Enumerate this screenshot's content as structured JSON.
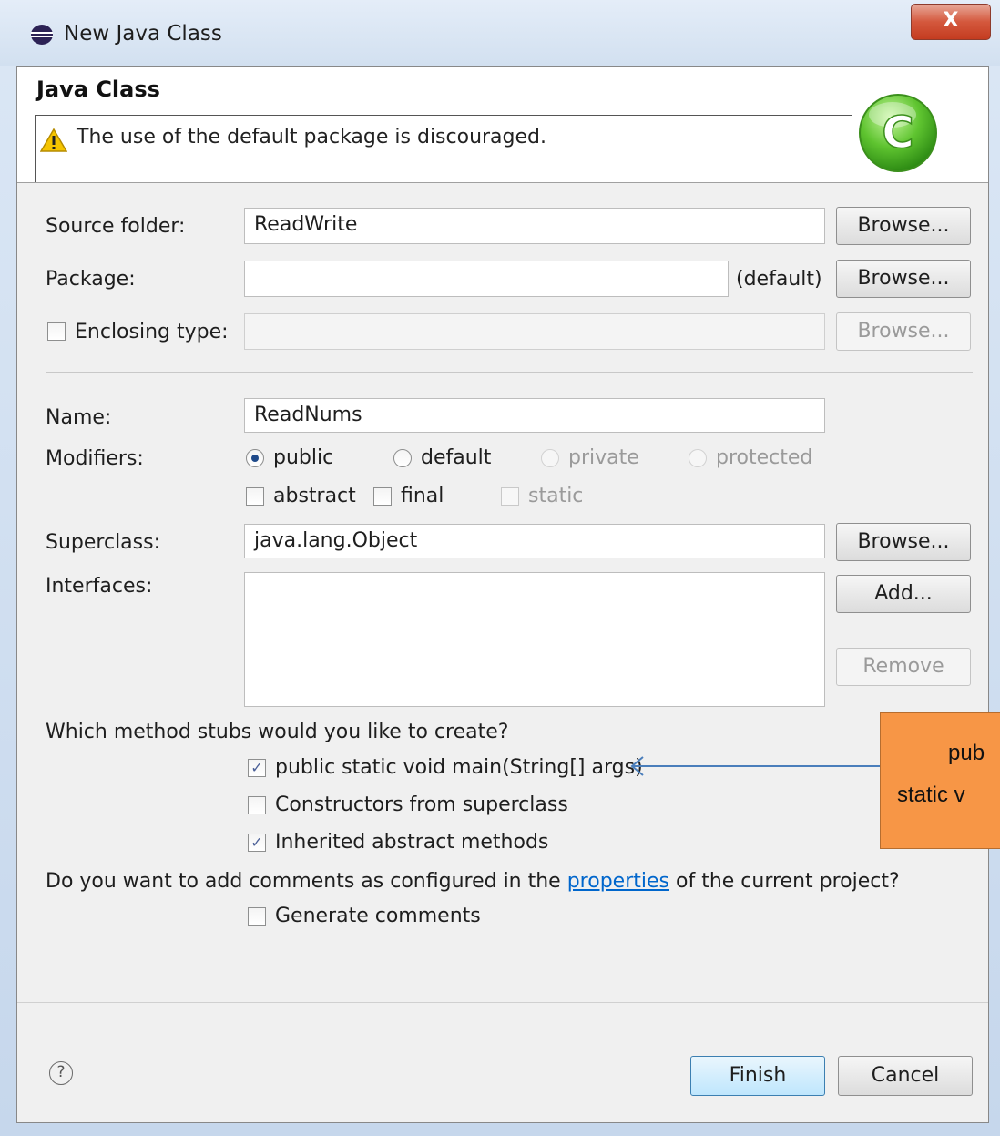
{
  "window": {
    "title": "New Java Class",
    "close_label": "X"
  },
  "header": {
    "title": "Java Class",
    "message": "The use of the default package is discouraged.",
    "icon_letter": "C"
  },
  "form": {
    "source_folder": {
      "label": "Source folder:",
      "value": "ReadWrite",
      "browse": "Browse..."
    },
    "package": {
      "label": "Package:",
      "value": "",
      "suffix": "(default)",
      "browse": "Browse..."
    },
    "enclosing_type": {
      "label": "Enclosing type:",
      "value": "",
      "checked": false,
      "browse": "Browse..."
    },
    "name": {
      "label": "Name:",
      "value": "ReadNums"
    },
    "modifiers": {
      "label": "Modifiers:",
      "radios": [
        "public",
        "default",
        "private",
        "protected"
      ],
      "selected": "public",
      "checkboxes": [
        "abstract",
        "final",
        "static"
      ]
    },
    "superclass": {
      "label": "Superclass:",
      "value": "java.lang.Object",
      "browse": "Browse..."
    },
    "interfaces": {
      "label": "Interfaces:",
      "add": "Add...",
      "remove": "Remove"
    }
  },
  "stubs": {
    "question": "Which method stubs would you like to create?",
    "options": [
      {
        "label": "public static void main(String[] args)",
        "checked": true
      },
      {
        "label": "Constructors from superclass",
        "checked": false
      },
      {
        "label": "Inherited abstract methods",
        "checked": true
      }
    ]
  },
  "comments": {
    "question_prefix": "Do you want to add comments as configured in the ",
    "link": "properties",
    "question_suffix": " of the current project?",
    "option": "Generate comments",
    "checked": false
  },
  "callout": {
    "line1": "pub",
    "line2": "static v",
    "color": "#f79646"
  },
  "footer": {
    "help": "?",
    "finish": "Finish",
    "cancel": "Cancel"
  }
}
